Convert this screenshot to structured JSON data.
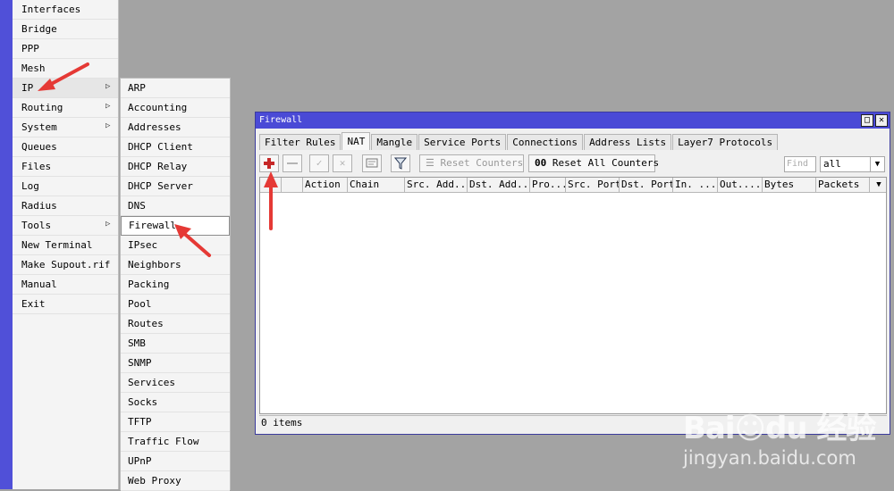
{
  "main_menu": {
    "items": [
      {
        "label": "Interfaces"
      },
      {
        "label": "Bridge"
      },
      {
        "label": "PPP"
      },
      {
        "label": "Mesh"
      },
      {
        "label": "IP",
        "has_submenu": true
      },
      {
        "label": "Routing",
        "has_submenu": true
      },
      {
        "label": "System",
        "has_submenu": true
      },
      {
        "label": "Queues"
      },
      {
        "label": "Files"
      },
      {
        "label": "Log"
      },
      {
        "label": "Radius"
      },
      {
        "label": "Tools",
        "has_submenu": true
      },
      {
        "label": "New Terminal"
      },
      {
        "label": "Make Supout.rif"
      },
      {
        "label": "Manual"
      },
      {
        "label": "Exit"
      }
    ]
  },
  "ip_submenu": {
    "items": [
      "ARP",
      "Accounting",
      "Addresses",
      "DHCP Client",
      "DHCP Relay",
      "DHCP Server",
      "DNS",
      "Firewall",
      "IPsec",
      "Neighbors",
      "Packing",
      "Pool",
      "Routes",
      "SMB",
      "SNMP",
      "Services",
      "Socks",
      "TFTP",
      "Traffic Flow",
      "UPnP",
      "Web Proxy"
    ],
    "highlighted": "Firewall"
  },
  "firewall_window": {
    "title": "Firewall",
    "tabs": [
      "Filter Rules",
      "NAT",
      "Mangle",
      "Service Ports",
      "Connections",
      "Address Lists",
      "Layer7 Protocols"
    ],
    "active_tab": "NAT",
    "toolbar": {
      "reset_counters": "Reset Counters",
      "reset_all_counters": "Reset All Counters",
      "find_placeholder": "Find",
      "filter_value": "all"
    },
    "columns": [
      "",
      "",
      "Action",
      "Chain",
      "Src. Add...",
      "Dst. Add...",
      "Pro...",
      "Src. Port",
      "Dst. Port",
      "In. ...",
      "Out....",
      "Bytes",
      "Packets"
    ],
    "rows": [],
    "status": "0 items"
  },
  "watermark": {
    "logo": "Bai☺du 经验",
    "url": "jingyan.baidu.com"
  },
  "colors": {
    "desktop": "#a3a3a3",
    "titlebar": "#4a4ad6",
    "sidebar_strip": "#5050d8",
    "annotation_arrow": "#e53935"
  }
}
